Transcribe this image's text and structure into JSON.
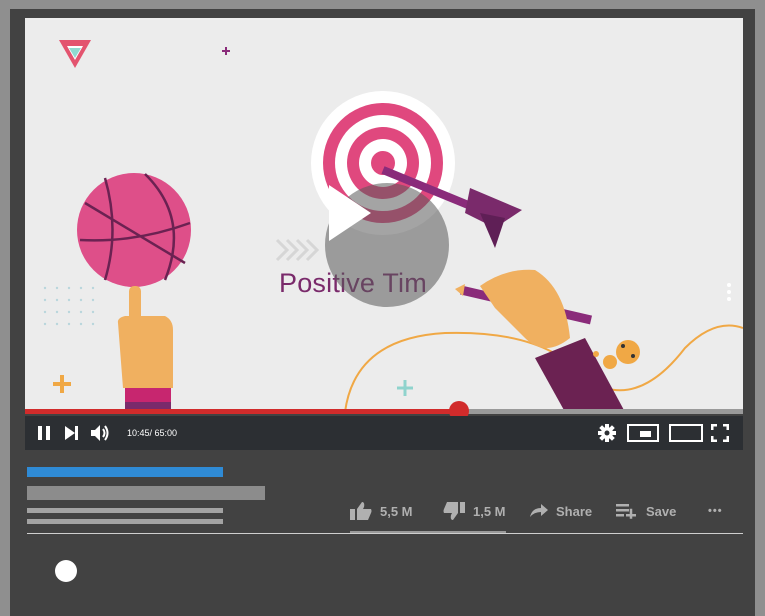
{
  "video": {
    "title_text": "Positive Tim",
    "icons": [
      "target-icon",
      "dart-icon",
      "basketball-icon",
      "hand-icon",
      "pencil-icon",
      "logo-triangle-icon"
    ]
  },
  "player": {
    "time_display": "10:45/ 65:00",
    "progress_fraction": 0.605,
    "accent_color": "#d12b2b"
  },
  "actions": {
    "like_count": "5,5 M",
    "dislike_count": "1,5 M",
    "share_label": "Share",
    "save_label": "Save",
    "more_label": "•••"
  }
}
